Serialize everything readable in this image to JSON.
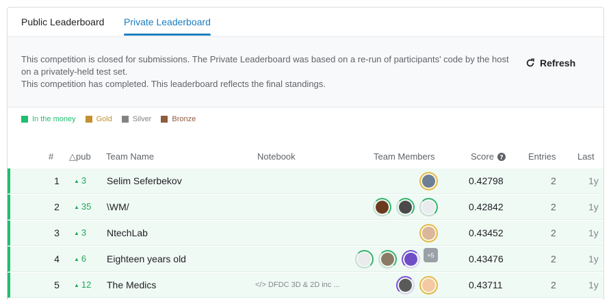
{
  "tabs": {
    "public": "Public Leaderboard",
    "private": "Private Leaderboard"
  },
  "info": {
    "line1": "This competition is closed for submissions. The Private Leaderboard was based on a re-run of participants' code by the host on a privately-held test set.",
    "line2": "This competition has completed. This leaderboard reflects the final standings."
  },
  "refresh_label": "Refresh",
  "legend": [
    {
      "label": "In the money",
      "color": "#20be6f"
    },
    {
      "label": "Gold",
      "color": "#c2912e"
    },
    {
      "label": "Silver",
      "color": "#838383"
    },
    {
      "label": "Bronze",
      "color": "#8e5b3d"
    }
  ],
  "columns": {
    "rank": "#",
    "delta": "△pub",
    "team": "Team Name",
    "notebook": "Notebook",
    "members": "Team Members",
    "score": "Score",
    "entries": "Entries",
    "last": "Last"
  },
  "rows": [
    {
      "rank": "1",
      "delta": "3",
      "team": "Selim Seferbekov",
      "notebook": "",
      "score": "0.42798",
      "entries": "2",
      "last": "1y"
    },
    {
      "rank": "2",
      "delta": "35",
      "team": "\\WM/",
      "notebook": "",
      "score": "0.42842",
      "entries": "2",
      "last": "1y"
    },
    {
      "rank": "3",
      "delta": "3",
      "team": "NtechLab",
      "notebook": "",
      "score": "0.43452",
      "entries": "2",
      "last": "1y"
    },
    {
      "rank": "4",
      "delta": "6",
      "team": "Eighteen years old",
      "notebook": "",
      "score": "0.43476",
      "entries": "2",
      "last": "1y",
      "more": "+5"
    },
    {
      "rank": "5",
      "delta": "12",
      "team": "The Medics",
      "notebook": "DFDC 3D & 2D inc ...",
      "score": "0.43711",
      "entries": "2",
      "last": "1y"
    }
  ],
  "colors": {
    "accent": "#1c7ec0",
    "money": "#20be6f",
    "delta": "#20a85c"
  }
}
